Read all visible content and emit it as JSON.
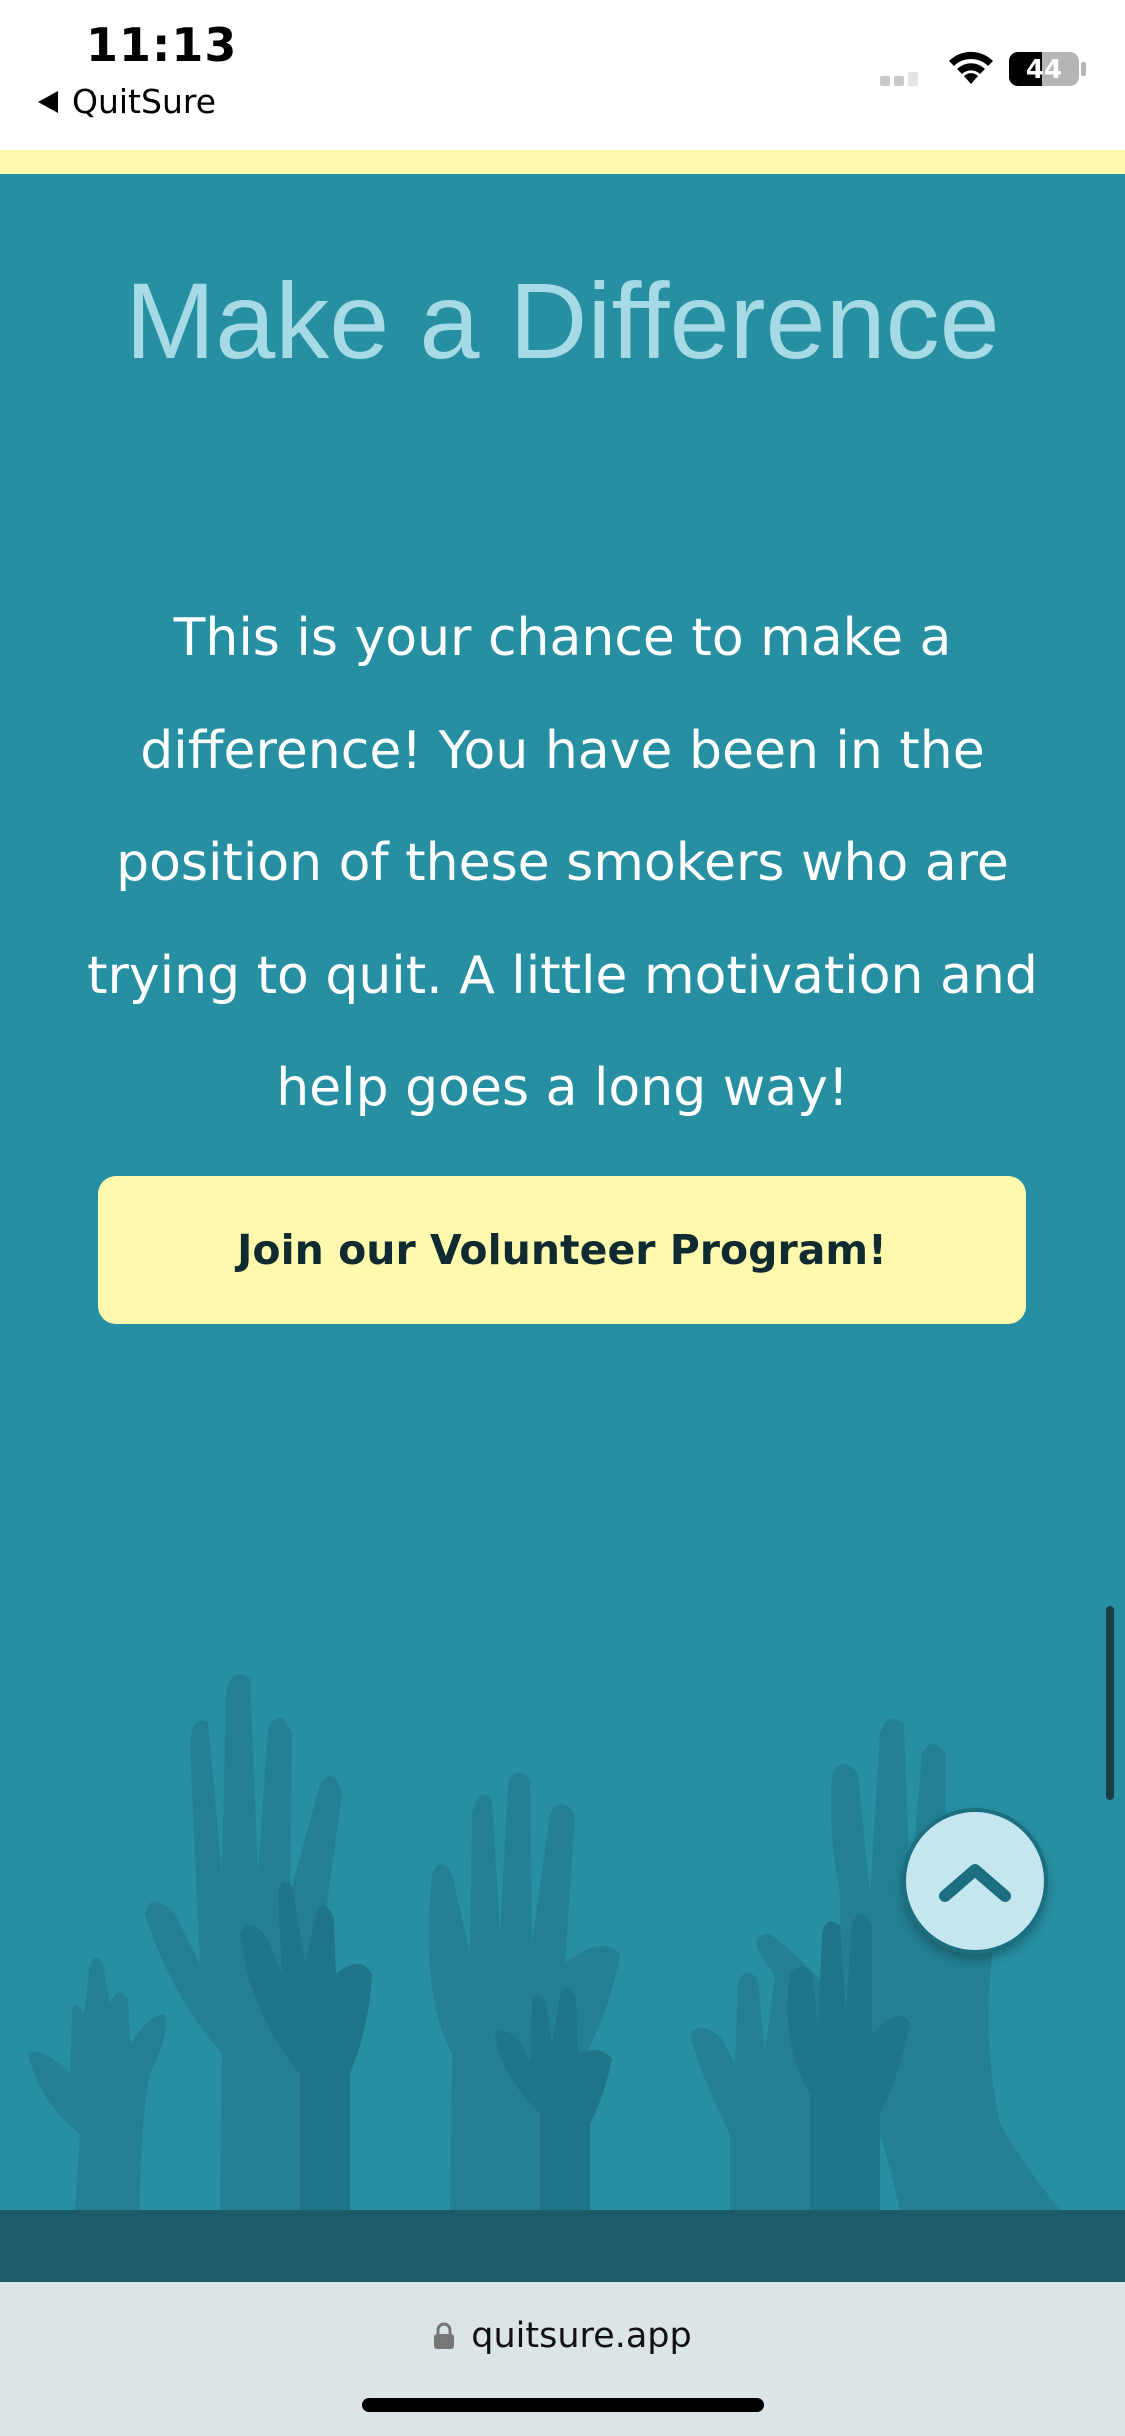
{
  "status_bar": {
    "time": "11:13",
    "back_app": "QuitSure",
    "battery_level": "44"
  },
  "section": {
    "headline": "Make a Difference",
    "body": "This is your chance to make a difference! You have been in the position of these smokers who are trying to quit. A little motivation and help goes a long way!",
    "cta_label": "Join our Volunteer Program!"
  },
  "browser": {
    "url": "quitsure.app"
  },
  "colors": {
    "accent_yellow": "#fff9ad",
    "teal_background": "#278fa2",
    "headline_color": "#a6dbe5",
    "footer_band": "#1e5b68"
  },
  "icons": [
    "back-arrow-icon",
    "signal-icon",
    "wifi-icon",
    "battery-icon",
    "scroll-to-top-icon",
    "lock-icon"
  ]
}
